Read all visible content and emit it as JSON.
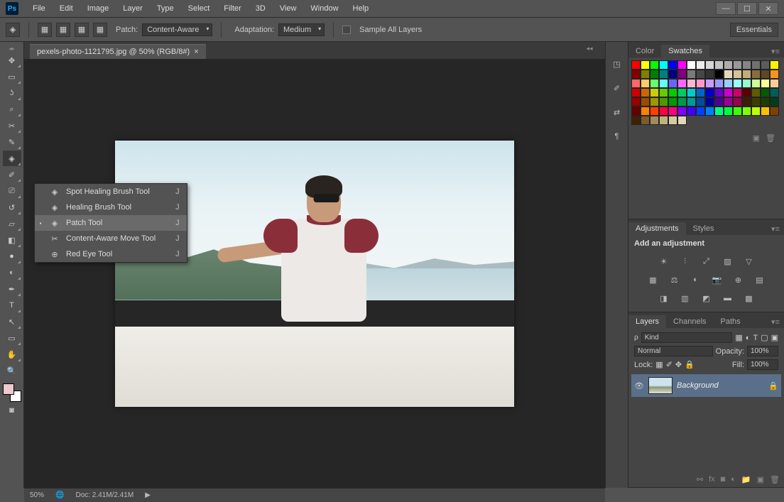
{
  "app": {
    "logo": "Ps"
  },
  "menu": [
    "File",
    "Edit",
    "Image",
    "Layer",
    "Type",
    "Select",
    "Filter",
    "3D",
    "View",
    "Window",
    "Help"
  ],
  "options": {
    "patch_label": "Patch:",
    "patch_value": "Content-Aware",
    "adaptation_label": "Adaptation:",
    "adaptation_value": "Medium",
    "sample_all": "Sample All Layers",
    "workspace": "Essentials"
  },
  "document": {
    "tab_title": "pexels-photo-1121795.jpg @ 50% (RGB/8#)",
    "zoom": "50%",
    "doc_info": "Doc: 2.41M/2.41M"
  },
  "flyout": {
    "items": [
      {
        "label": "Spot Healing Brush Tool",
        "shortcut": "J",
        "selected": false
      },
      {
        "label": "Healing Brush Tool",
        "shortcut": "J",
        "selected": false
      },
      {
        "label": "Patch Tool",
        "shortcut": "J",
        "selected": true
      },
      {
        "label": "Content-Aware Move Tool",
        "shortcut": "J",
        "selected": false
      },
      {
        "label": "Red Eye Tool",
        "shortcut": "J",
        "selected": false
      }
    ]
  },
  "panels": {
    "color_tab": "Color",
    "swatches_tab": "Swatches",
    "swatches": [
      "#ff0000",
      "#ffff00",
      "#00ff00",
      "#00ffff",
      "#0000ff",
      "#ff00ff",
      "#ffffff",
      "#ebebeb",
      "#d6d6d6",
      "#c2c2c2",
      "#adadad",
      "#999999",
      "#858585",
      "#707070",
      "#5c5c5c",
      "#fff200",
      "#800000",
      "#808000",
      "#008000",
      "#008080",
      "#000080",
      "#800080",
      "#7a7a7a",
      "#474747",
      "#333333",
      "#000000",
      "#e6d7bb",
      "#d4c29a",
      "#c2ad7a",
      "#8a6d3b",
      "#5c4827",
      "#f7941d",
      "#ff6666",
      "#ffcc66",
      "#66ff66",
      "#66ffff",
      "#6666ff",
      "#ff66ff",
      "#f7b6d2",
      "#ff99cc",
      "#cc99ff",
      "#9999ff",
      "#99ccff",
      "#99ffff",
      "#99ffcc",
      "#ccff99",
      "#ffff99",
      "#ffcc99",
      "#cc0000",
      "#cc6600",
      "#cccc00",
      "#66cc00",
      "#00cc00",
      "#00cc66",
      "#00cccc",
      "#0066cc",
      "#0000cc",
      "#6600cc",
      "#cc00cc",
      "#cc0066",
      "#5c0000",
      "#5c5c00",
      "#005c00",
      "#005c5c",
      "#990000",
      "#994d00",
      "#999900",
      "#4d9900",
      "#009900",
      "#00994d",
      "#009999",
      "#004d99",
      "#000099",
      "#4d0099",
      "#990099",
      "#99004d",
      "#3d1f00",
      "#3d3d00",
      "#1f3d00",
      "#003d1f",
      "#660000",
      "#ff8000",
      "#ff4000",
      "#ff0040",
      "#ff0080",
      "#8000ff",
      "#4000ff",
      "#0040ff",
      "#0080ff",
      "#00ff80",
      "#00ff40",
      "#40ff00",
      "#80ff00",
      "#bfff00",
      "#ffbf00",
      "#804000",
      "#402000",
      "#7a5c2e",
      "#a38a5c",
      "#c2b280",
      "#d6c9a3",
      "#e0d6b8"
    ],
    "adjustments_tab": "Adjustments",
    "styles_tab": "Styles",
    "add_adjustment": "Add an adjustment",
    "layers_tab": "Layers",
    "channels_tab": "Channels",
    "paths_tab": "Paths",
    "kind": "Kind",
    "blend_mode": "Normal",
    "opacity_label": "Opacity:",
    "opacity_value": "100%",
    "lock_label": "Lock:",
    "fill_label": "Fill:",
    "fill_value": "100%",
    "layer_name": "Background"
  }
}
